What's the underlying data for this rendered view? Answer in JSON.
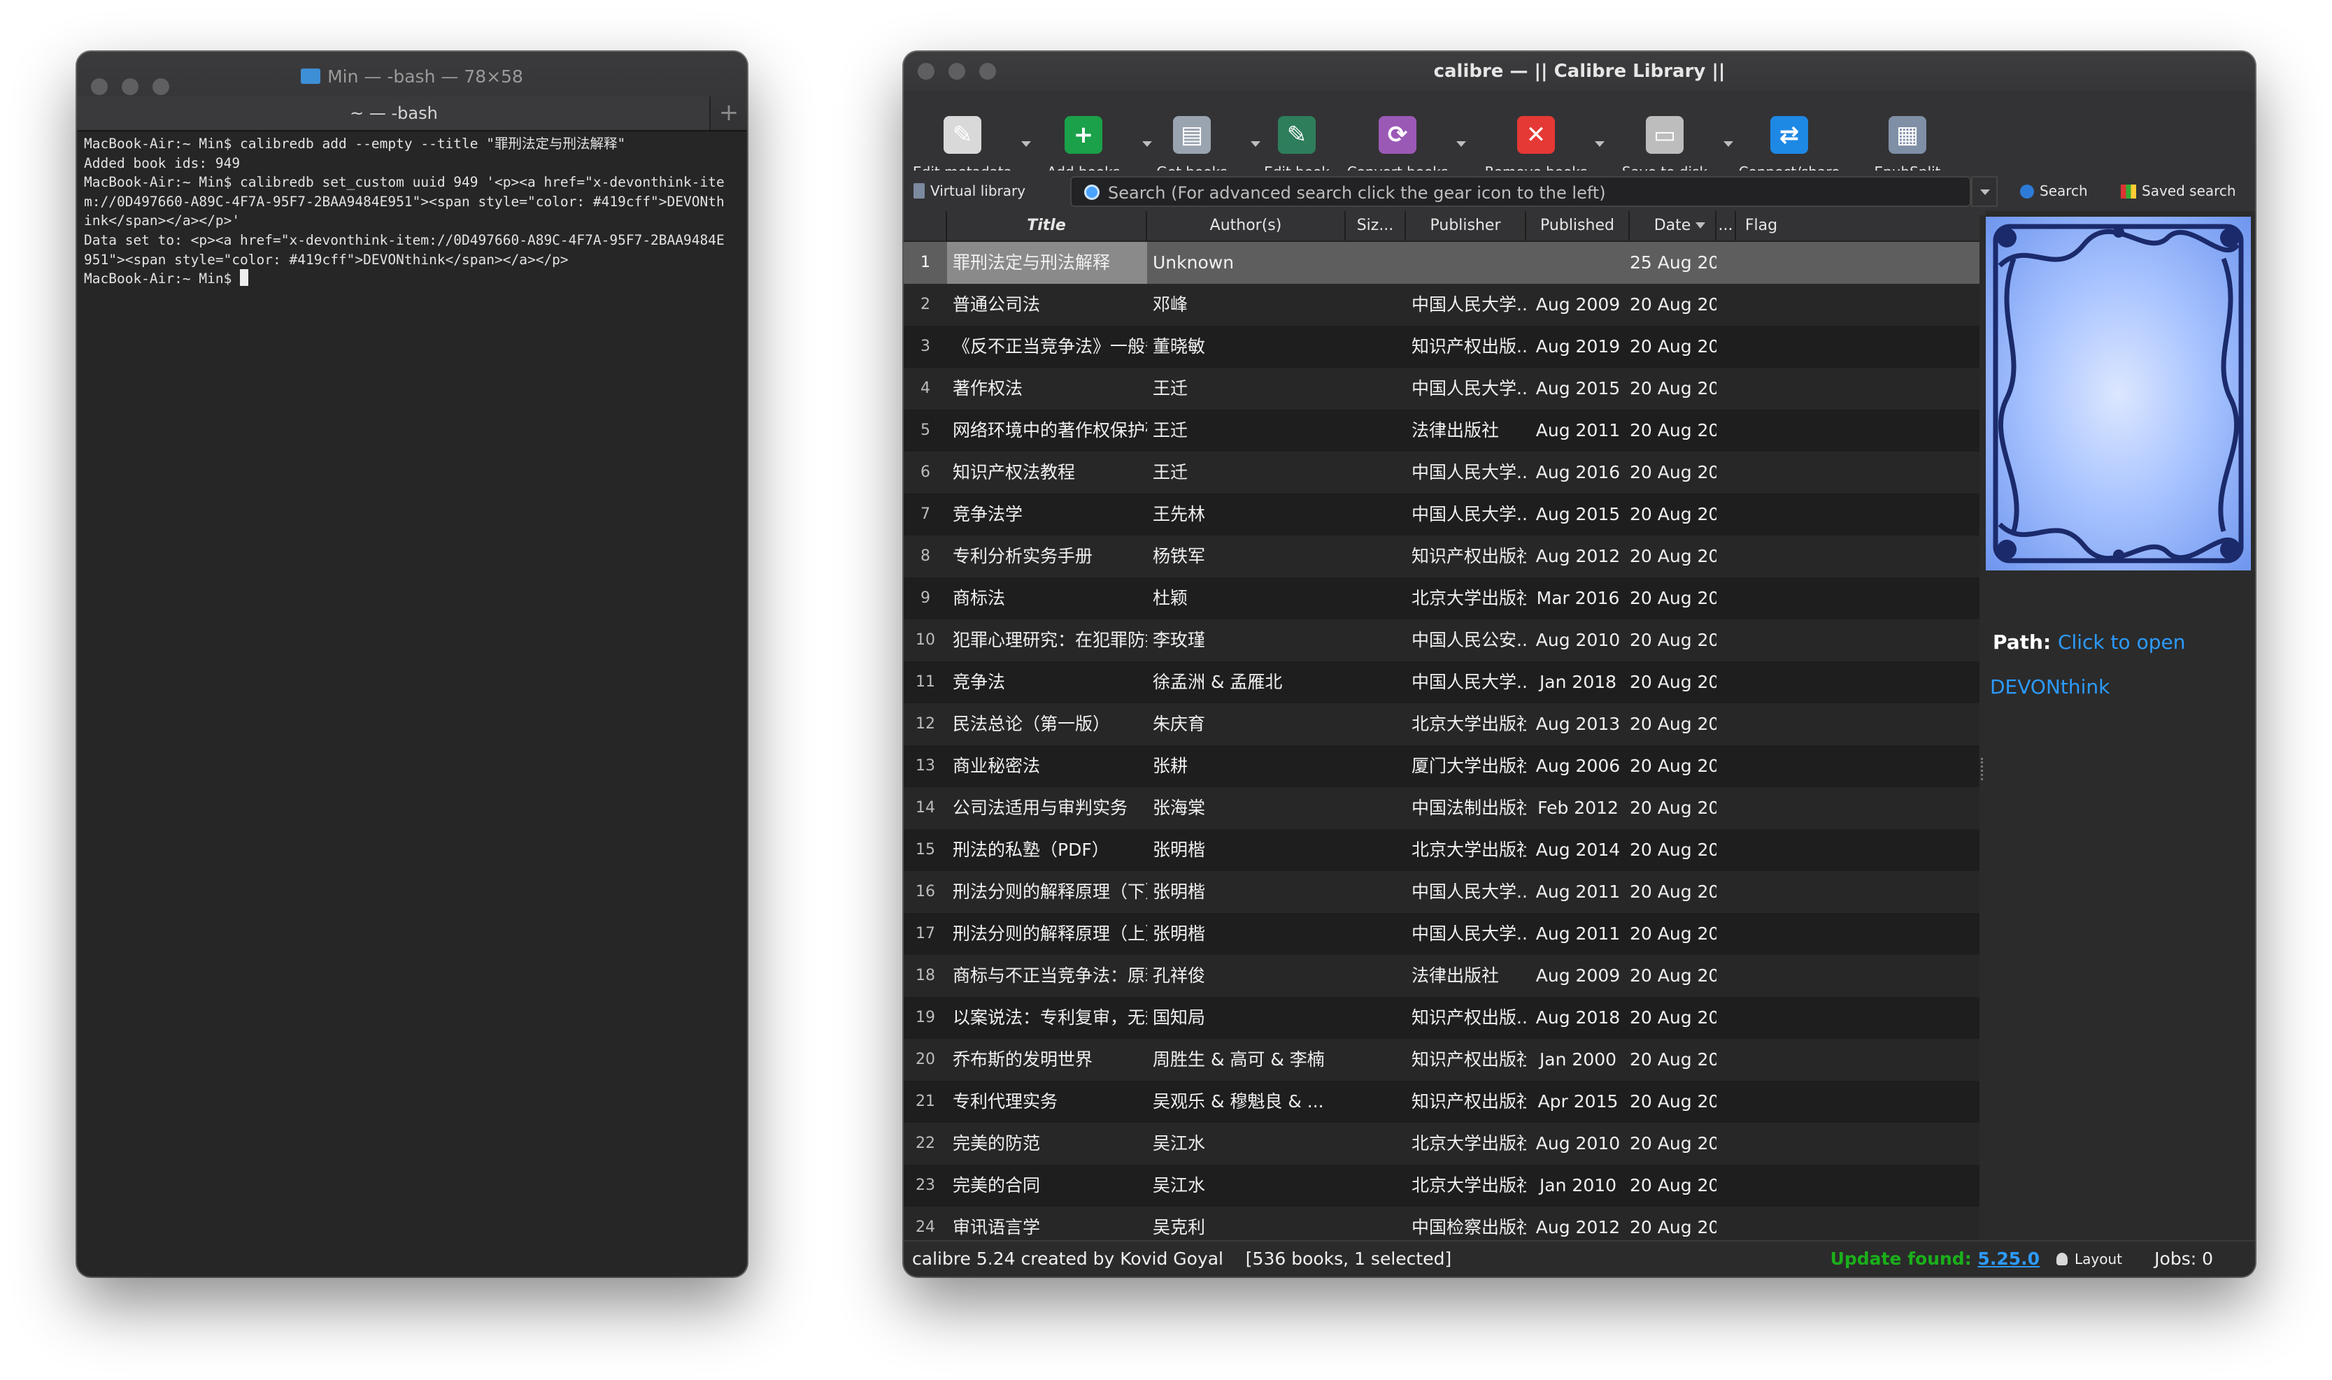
{
  "terminal": {
    "title": "Min — -bash — 78×58",
    "tab_label": "~ — -bash",
    "lines": [
      "MacBook-Air:~ Min$ calibredb add --empty --title \"罪刑法定与刑法解释\"",
      "Added book ids: 949",
      "MacBook-Air:~ Min$ calibredb set_custom uuid 949 '<p><a href=\"x-devonthink-ite",
      "m://0D497660-A89C-4F7A-95F7-2BAA9484E951\"><span style=\"color: #419cff\">DEVONth",
      "ink</span></a></p>'",
      "Data set to: <p><a href=\"x-devonthink-item://0D497660-A89C-4F7A-95F7-2BAA9484E",
      "951\"><span style=\"color: #419cff\">DEVONthink</span></a></p>",
      "MacBook-Air:~ Min$ "
    ]
  },
  "calibre": {
    "title": "calibre — || Calibre Library ||",
    "toolbar": [
      {
        "label": "Edit metadata",
        "icon": "edit-metadata-icon",
        "color": "#d9d9d9",
        "glyph": "✎"
      },
      {
        "label": "Add books",
        "icon": "add-books-icon",
        "color": "#1aa14a",
        "glyph": "+"
      },
      {
        "label": "Get books",
        "icon": "get-books-icon",
        "color": "#9aa4b0",
        "glyph": "▤"
      },
      {
        "label": "Edit book",
        "icon": "edit-book-icon",
        "color": "#2e7d5b",
        "glyph": "✎"
      },
      {
        "label": "Convert books",
        "icon": "convert-books-icon",
        "color": "#9b59b6",
        "glyph": "⟳"
      },
      {
        "label": "Remove books",
        "icon": "remove-books-icon",
        "color": "#e53935",
        "glyph": "✕"
      },
      {
        "label": "Save to disk",
        "icon": "save-to-disk-icon",
        "color": "#bdbdbd",
        "glyph": "▭"
      },
      {
        "label": "Connect/share",
        "icon": "connect-share-icon",
        "color": "#1e88e5",
        "glyph": "⇄"
      },
      {
        "label": "EpubSplit",
        "icon": "epubsplit-icon",
        "color": "#7f8fa6",
        "glyph": "▦"
      }
    ],
    "virtual_library": "Virtual library",
    "search_placeholder": "Search (For advanced search click the gear icon to the left)",
    "search_button": "Search",
    "saved_search": "Saved search",
    "columns": {
      "title": "Title",
      "authors": "Author(s)",
      "size": "Siz...",
      "publisher": "Publisher",
      "published": "Published",
      "date": "Date",
      "more": "...",
      "flag": "Flag"
    },
    "rows": [
      {
        "n": "1",
        "title": "罪刑法定与刑法解释",
        "author": "Unknown",
        "publisher": "",
        "published": "",
        "date": "25 Aug 20...",
        "selected": true
      },
      {
        "n": "2",
        "title": "普通公司法",
        "author": "邓峰",
        "publisher": "中国人民大学...",
        "published": "Aug 2009",
        "date": "20 Aug 20..."
      },
      {
        "n": "3",
        "title": "《反不正当竞争法》一般条款的适用",
        "author": "董晓敏",
        "publisher": "知识产权出版...",
        "published": "Aug 2019",
        "date": "20 Aug 20..."
      },
      {
        "n": "4",
        "title": "著作权法",
        "author": "王迁",
        "publisher": "中国人民大学...",
        "published": "Aug 2015",
        "date": "20 Aug 20..."
      },
      {
        "n": "5",
        "title": "网络环境中的著作权保护研究",
        "author": "王迁",
        "publisher": "法律出版社",
        "published": "Aug 2011",
        "date": "20 Aug 20..."
      },
      {
        "n": "6",
        "title": "知识产权法教程",
        "author": "王迁",
        "publisher": "中国人民大学...",
        "published": "Aug 2016",
        "date": "20 Aug 20..."
      },
      {
        "n": "7",
        "title": "竞争法学",
        "author": "王先林",
        "publisher": "中国人民大学...",
        "published": "Aug 2015",
        "date": "20 Aug 20..."
      },
      {
        "n": "8",
        "title": "专利分析实务手册",
        "author": "杨铁军",
        "publisher": "知识产权出版社",
        "published": "Aug 2012",
        "date": "20 Aug 20..."
      },
      {
        "n": "9",
        "title": "商标法",
        "author": "杜颖",
        "publisher": "北京大学出版社",
        "published": "Mar 2016",
        "date": "20 Aug 20..."
      },
      {
        "n": "10",
        "title": "犯罪心理研究：在犯罪防控中的作用",
        "author": "李玫瑾",
        "publisher": "中国人民公安...",
        "published": "Aug 2010",
        "date": "20 Aug 20..."
      },
      {
        "n": "11",
        "title": "竞争法",
        "author": "徐孟洲 & 孟雁北",
        "publisher": "中国人民大学...",
        "published": "Jan 2018",
        "date": "20 Aug 20..."
      },
      {
        "n": "12",
        "title": "民法总论（第一版）",
        "author": "朱庆育",
        "publisher": "北京大学出版社",
        "published": "Aug 2013",
        "date": "20 Aug 20..."
      },
      {
        "n": "13",
        "title": "商业秘密法",
        "author": "张耕",
        "publisher": "厦门大学出版社",
        "published": "Aug 2006",
        "date": "20 Aug 20..."
      },
      {
        "n": "14",
        "title": "公司法适用与审判实务",
        "author": "张海棠",
        "publisher": "中国法制出版社",
        "published": "Feb 2012",
        "date": "20 Aug 20..."
      },
      {
        "n": "15",
        "title": "刑法的私塾（PDF）",
        "author": "张明楷",
        "publisher": "北京大学出版社",
        "published": "Aug 2014",
        "date": "20 Aug 20..."
      },
      {
        "n": "16",
        "title": "刑法分则的解释原理（下）",
        "author": "张明楷",
        "publisher": "中国人民大学...",
        "published": "Aug 2011",
        "date": "20 Aug 20..."
      },
      {
        "n": "17",
        "title": "刑法分则的解释原理（上）",
        "author": "张明楷",
        "publisher": "中国人民大学...",
        "published": "Aug 2011",
        "date": "20 Aug 20..."
      },
      {
        "n": "18",
        "title": "商标与不正当竞争法：原理和判例",
        "author": "孔祥俊",
        "publisher": "法律出版社",
        "published": "Aug 2009",
        "date": "20 Aug 20..."
      },
      {
        "n": "19",
        "title": "以案说法：专利复审，无效典型案例...",
        "author": "国知局",
        "publisher": "知识产权出版...",
        "published": "Aug 2018",
        "date": "20 Aug 20..."
      },
      {
        "n": "20",
        "title": "乔布斯的发明世界",
        "author": "周胜生 & 高可 & 李楠",
        "publisher": "知识产权出版社",
        "published": "Jan 2000",
        "date": "20 Aug 20..."
      },
      {
        "n": "21",
        "title": "专利代理实务",
        "author": "吴观乐 & 穆魁良 & ...",
        "publisher": "知识产权出版社",
        "published": "Apr 2015",
        "date": "20 Aug 20..."
      },
      {
        "n": "22",
        "title": "完美的防范",
        "author": "吴江水",
        "publisher": "北京大学出版社",
        "published": "Aug 2010",
        "date": "20 Aug 20..."
      },
      {
        "n": "23",
        "title": "完美的合同",
        "author": "吴江水",
        "publisher": "北京大学出版社",
        "published": "Jan 2010",
        "date": "20 Aug 20..."
      },
      {
        "n": "24",
        "title": "审讯语言学",
        "author": "吴克利",
        "publisher": "中国检察出版社",
        "published": "Aug 2012",
        "date": "20 Aug 20..."
      }
    ],
    "details": {
      "path_label": "Path:",
      "path_link": "Click to open",
      "devonthink_link": "DEVONthink",
      "link_color": "#2c9bff"
    },
    "status": {
      "left": "calibre 5.24 created by Kovid Goyal    [536 books, 1 selected]",
      "update_label": "Update found:",
      "update_version": "5.25.0",
      "layout": "Layout",
      "jobs": "Jobs: 0"
    }
  }
}
